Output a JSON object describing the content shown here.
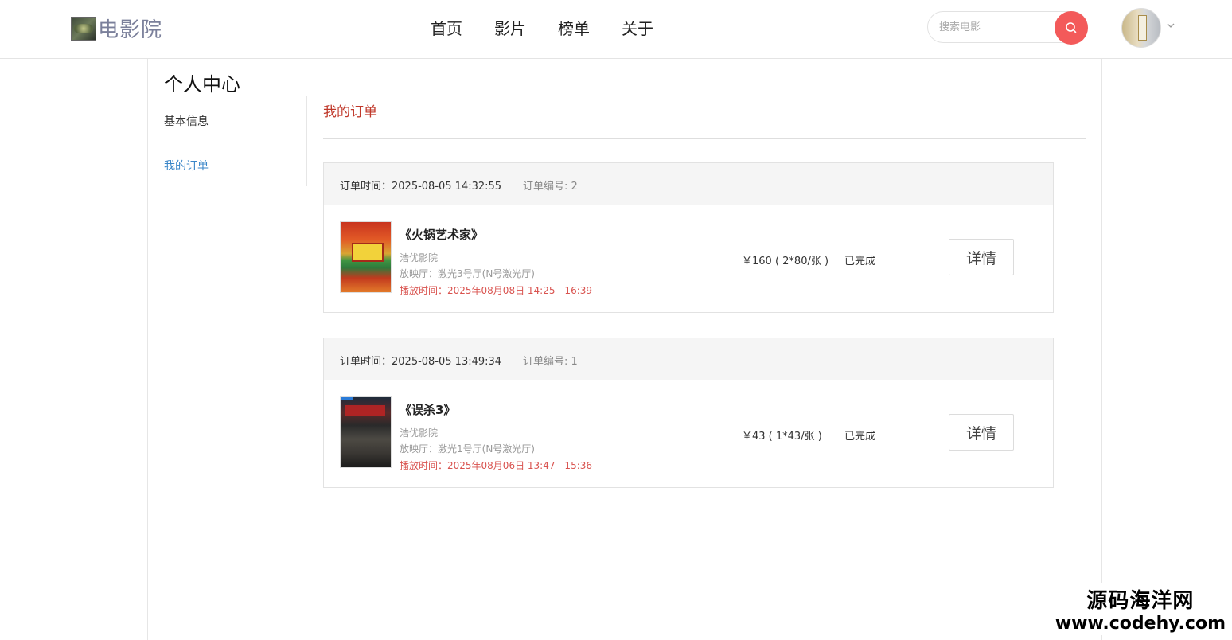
{
  "header": {
    "logo_text": "电影院",
    "nav": [
      "首页",
      "影片",
      "榜单",
      "关于"
    ],
    "search_placeholder": "搜索电影"
  },
  "page": {
    "title": "个人中心",
    "sidebar": {
      "basic_info": "基本信息",
      "my_orders": "我的订单"
    },
    "section_title": "我的订单"
  },
  "orders": [
    {
      "time_label": "订单时间：2025-08-05 14:32:55",
      "number_label": "订单编号: 2",
      "movie": "《火锅艺术家》",
      "cinema": "浩优影院",
      "hall": "放映厅：激光3号厅(N号激光厅)",
      "showtime": "播放时间：2025年08月08日 14:25 - 16:39",
      "price": "￥160 ( 2*80/张 )",
      "status": "已完成",
      "detail_label": "详情"
    },
    {
      "time_label": "订单时间：2025-08-05 13:49:34",
      "number_label": "订单编号: 1",
      "movie": "《误杀3》",
      "cinema": "浩优影院",
      "hall": "放映厅：激光1号厅(N号激光厅)",
      "showtime": "播放时间：2025年08月06日 13:47 - 15:36",
      "price": "￥43 ( 1*43/张 )",
      "status": "已完成",
      "detail_label": "详情"
    }
  ],
  "watermark": {
    "line1": "源码海洋网",
    "line2": "www.codehy.com"
  },
  "colors": {
    "accent_red": "#c0392b",
    "search_button": "#f35a5a",
    "link_blue": "#3a86c8"
  }
}
